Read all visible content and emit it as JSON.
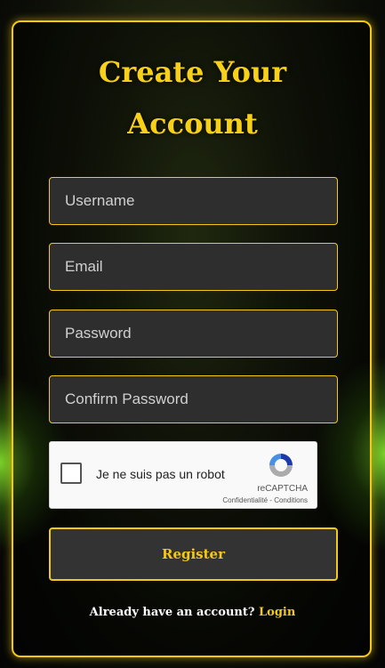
{
  "form": {
    "title_line1": "Create Your",
    "title_line2": "Account",
    "username_placeholder": "Username",
    "email_placeholder": "Email",
    "password_placeholder": "Password",
    "confirm_password_placeholder": "Confirm Password",
    "register_label": "Register",
    "login_prompt": "Already have an account?",
    "login_link": "Login"
  },
  "captcha": {
    "label": "Je ne suis pas un robot",
    "brand": "reCAPTCHA",
    "privacy": "Confidentialité",
    "separator": " - ",
    "terms": "Conditions",
    "checked": false
  },
  "colors": {
    "accent": "#f3c913",
    "field_bg": "#2e2e2e"
  }
}
